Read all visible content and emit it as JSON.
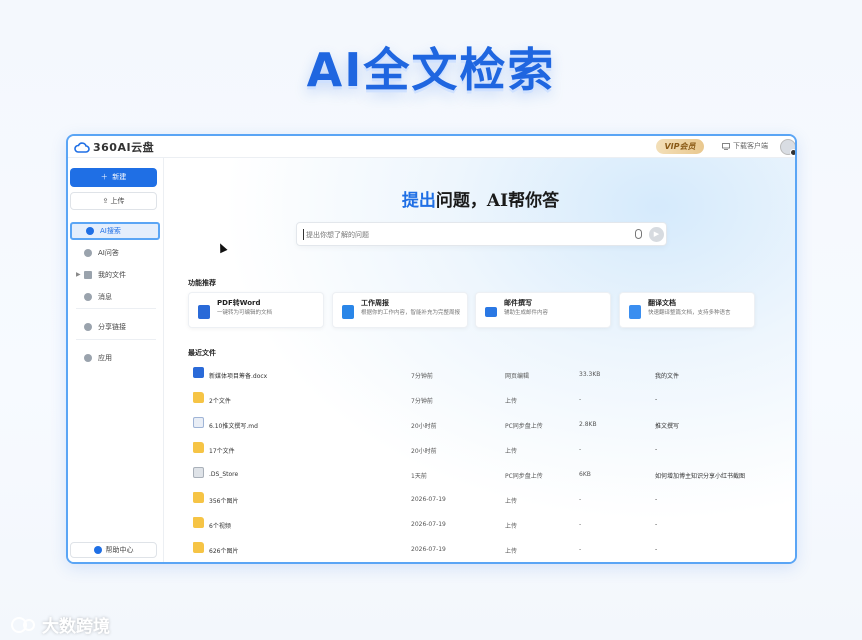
{
  "hero": {
    "title": "AI全文检索"
  },
  "topbar": {
    "logo_text": "360AI云盘",
    "vip_label": "VIP会员",
    "download_label": "下载客户端"
  },
  "sidebar": {
    "new_label": "新建",
    "upload_label": "上传",
    "items": [
      {
        "label": "AI搜索",
        "icon": "ai-search-icon",
        "active": true
      },
      {
        "label": "AI问答",
        "icon": "ai-qa-icon"
      },
      {
        "label": "我的文件",
        "icon": "folder-icon"
      },
      {
        "label": "消息",
        "icon": "bell-icon"
      },
      {
        "label": "分享链接",
        "icon": "share-icon"
      },
      {
        "label": "应用",
        "icon": "app-icon"
      }
    ],
    "help_label": "帮助中心"
  },
  "main": {
    "search_title_accent": "提出",
    "search_title_rest": "问题，AI帮你答",
    "search_placeholder": "提出你想了解的问题",
    "features_heading": "功能推荐",
    "features": [
      {
        "title": "PDF转Word",
        "desc": "一键转为可编辑的文档",
        "color": "#2a6ad8"
      },
      {
        "title": "工作周报",
        "desc": "根据你的工作内容，智能补充为完整周报",
        "color": "#2a86e8"
      },
      {
        "title": "邮件撰写",
        "desc": "辅助生成邮件内容",
        "color": "#2a78e4"
      },
      {
        "title": "翻译文档",
        "desc": "快速翻译整篇文档，支持多种语言",
        "color": "#3a8ef0"
      }
    ],
    "recent_heading": "最近文件",
    "files": [
      {
        "name": "新媒体项目筹备.docx",
        "time": "7分钟前",
        "source": "网页编辑",
        "size": "33.3KB",
        "location": "我的文件",
        "icon": "word"
      },
      {
        "name": "2个文件",
        "time": "7分钟前",
        "source": "上传",
        "size": "-",
        "location": "-",
        "icon": "folder"
      },
      {
        "name": "6.10推文撰写.md",
        "time": "20小时前",
        "source": "PC同步盘上传",
        "size": "2.8KB",
        "location": "推文撰写",
        "icon": "doc"
      },
      {
        "name": "17个文件",
        "time": "20小时前",
        "source": "上传",
        "size": "-",
        "location": "-",
        "icon": "folder"
      },
      {
        "name": ".DS_Store",
        "time": "1天前",
        "source": "PC同步盘上传",
        "size": "6KB",
        "location": "如何增加博主知识分享小红书截图",
        "icon": "file"
      },
      {
        "name": "356个图片",
        "time": "2026-07-19",
        "source": "上传",
        "size": "-",
        "location": "-",
        "icon": "folder"
      },
      {
        "name": "6个视频",
        "time": "2026-07-19",
        "source": "上传",
        "size": "-",
        "location": "-",
        "icon": "folder"
      },
      {
        "name": "626个图片",
        "time": "2026-07-19",
        "source": "上传",
        "size": "-",
        "location": "-",
        "icon": "folder"
      }
    ]
  },
  "watermark": {
    "text": "大数跨境"
  }
}
